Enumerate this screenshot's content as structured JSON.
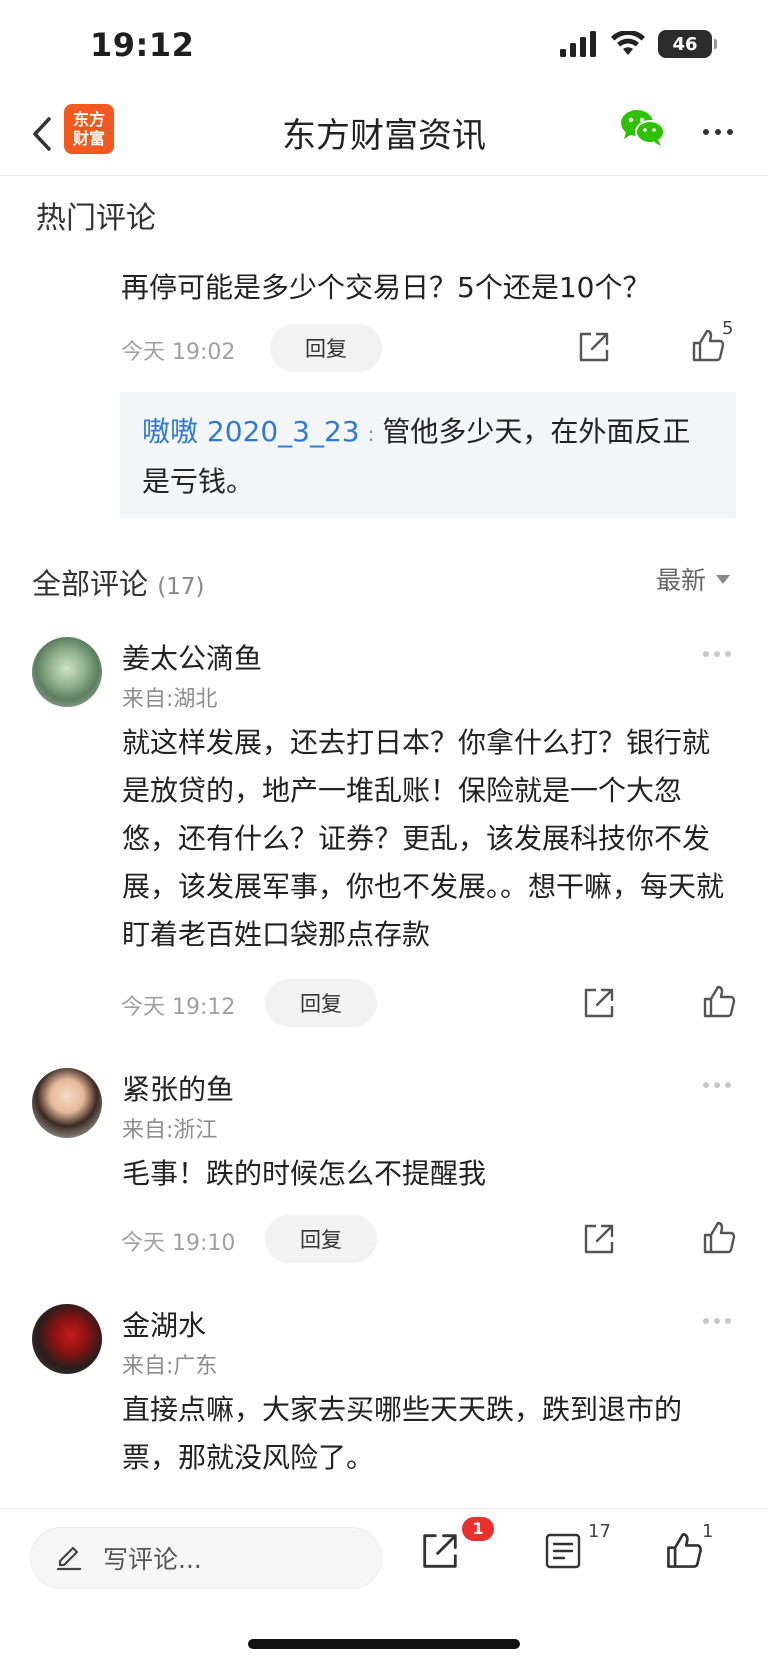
{
  "status": {
    "time": "19:12",
    "battery": "46"
  },
  "nav": {
    "logo_line1": "东方",
    "logo_line2": "财富",
    "title": "东方财富资讯"
  },
  "hot_section": {
    "label": "热门评论",
    "comment": {
      "text": "再停可能是多少个交易日？5个还是10个？",
      "time": "今天 19:02",
      "reply_label": "回复",
      "likes": "5",
      "quote_user": "嗷嗷 2020_3_23",
      "quote_colon": ":",
      "quote_text": "管他多少天，在外面反正是亏钱。"
    }
  },
  "all_section": {
    "label": "全部评论",
    "count": "(17)",
    "sort_label": "最新"
  },
  "comments": [
    {
      "name": "姜太公滴鱼",
      "location": "来自:湖北",
      "text": "就这样发展，还去打日本？你拿什么打？银行就是放贷的，地产一堆乱账！保险就是一个大忽悠，还有什么？证券？更乱，该发展科技你不发展，该发展军事，你也不发展。。想干嘛，每天就盯着老百姓口袋那点存款",
      "time": "今天 19:12",
      "reply_label": "回复"
    },
    {
      "name": "紧张的鱼",
      "location": "来自:浙江",
      "text": "毛事！跌的时候怎么不提醒我",
      "time": "今天 19:10",
      "reply_label": "回复"
    },
    {
      "name": "金湖水",
      "location": "来自:广东",
      "text": "直接点嘛，大家去买哪些天天跌，跌到退市的票，那就没风险了。"
    }
  ],
  "bottom_bar": {
    "write_placeholder": "写评论...",
    "share_badge": "1",
    "comment_count": "17",
    "like_count": "1"
  },
  "icons": [
    "back-icon",
    "wechat-icon",
    "more-icon",
    "share-icon",
    "like-icon",
    "pencil-icon",
    "comments-icon"
  ],
  "colors": {
    "brand": "#f2591e",
    "link": "#2f7ad6",
    "badge": "#e9302d",
    "wechat": "#2dc100"
  }
}
